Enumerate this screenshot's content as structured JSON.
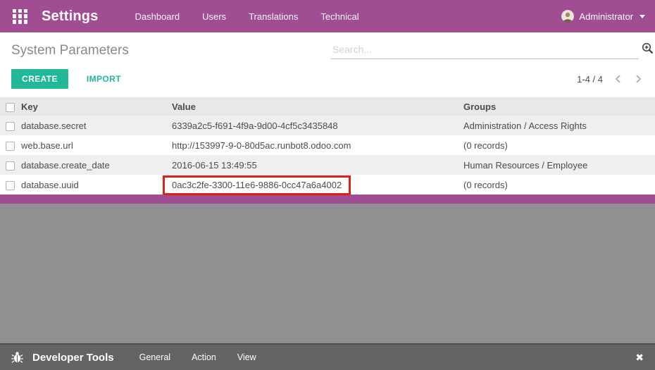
{
  "topbar": {
    "app_title": "Settings",
    "menu_items": [
      "Dashboard",
      "Users",
      "Translations",
      "Technical"
    ],
    "user_name": "Administrator"
  },
  "content": {
    "page_title": "System Parameters",
    "search_placeholder": "Search...",
    "create_label": "CREATE",
    "import_label": "IMPORT",
    "pager_text": "1-4 / 4"
  },
  "table": {
    "headers": {
      "key": "Key",
      "value": "Value",
      "groups": "Groups"
    },
    "rows": [
      {
        "key": "database.secret",
        "value": "6339a2c5-f691-4f9a-9d00-4cf5c3435848",
        "groups": "Administration / Access Rights"
      },
      {
        "key": "web.base.url",
        "value": "http://153997-9-0-80d5ac.runbot8.odoo.com",
        "groups": "(0 records)"
      },
      {
        "key": "database.create_date",
        "value": "2016-06-15 13:49:55",
        "groups": "Human Resources / Employee"
      },
      {
        "key": "database.uuid",
        "value": "0ac3c2fe-3300-11e6-9886-0cc47a6a4002",
        "groups": "(0 records)",
        "highlighted": true
      }
    ]
  },
  "devtools": {
    "title": "Developer Tools",
    "menu_items": [
      "General",
      "Action",
      "View"
    ],
    "close_glyph": "✖"
  },
  "colors": {
    "brand_magenta": "#a04d93",
    "accent_teal": "#21b799",
    "highlight_red": "#df1f1a",
    "canvas_gray": "#909090",
    "devbar_gray": "#646464"
  }
}
